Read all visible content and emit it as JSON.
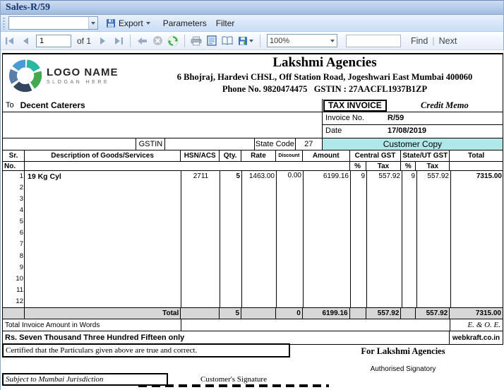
{
  "window": {
    "title": "Sales-R/59"
  },
  "toolbar": {
    "report_combo_value": "",
    "export_label": "Export",
    "parameters_label": "Parameters",
    "filter_label": "Filter"
  },
  "nav": {
    "page_value": "1",
    "of_label": "of 1",
    "zoom_value": "100%",
    "find_value": "",
    "find_label": "Find",
    "separator": "|",
    "next_label": "Next"
  },
  "company": {
    "logo_name": "LOGO NAME",
    "logo_slogan": "SLOGAN HERE",
    "name": "Lakshmi Agencies",
    "address": "6 Bhojraj, Hardevi CHSL, Off Station Road, Jogeshwari East Mumbai 400060",
    "phone_line": "Phone No. 9820474475   GSTIN : 27AACFL1937B1ZP"
  },
  "invoice": {
    "to_label": "To",
    "to_name": "Decent Caterers",
    "type_label": "TAX INVOICE",
    "memo_label": "Credit Memo",
    "invoice_no_label": "Invoice No.",
    "invoice_no": "R/59",
    "date_label": "Date",
    "date": "17/08/2019",
    "gstin_label": "GSTIN",
    "gstin_value": "",
    "state_code_label": "State Code",
    "state_code": "27",
    "copy_label": "Customer Copy"
  },
  "table": {
    "col_sr": "Sr.",
    "col_no": "No.",
    "col_desc": "Description of Goods/Services",
    "col_hsn": "HSN/ACS",
    "col_qty": "Qty.",
    "col_rate": "Rate",
    "col_discount": "Discount",
    "col_amount": "Amount",
    "col_cgst": "Central GST",
    "col_sgst": "State/UT GST",
    "col_total": "Total",
    "col_pct": "%",
    "col_tax": "Tax",
    "sr_numbers": [
      "1",
      "2",
      "3",
      "4",
      "5",
      "6",
      "7",
      "8",
      "9",
      "10",
      "11",
      "12"
    ],
    "row1": {
      "desc": "19 Kg Cyl",
      "hsn": "2711",
      "qty": "5",
      "rate": "1463.00",
      "discount": "0.00",
      "amount": "6199.16",
      "cgst_pct": "9",
      "cgst_tax": "557.92",
      "sgst_pct": "9",
      "sgst_tax": "557.92",
      "total": "7315.00"
    },
    "totals": {
      "label": "Total",
      "qty": "5",
      "discount": "0",
      "amount": "6199.16",
      "cgst_tax": "557.92",
      "sgst_tax": "557.92",
      "total": "7315.00"
    }
  },
  "footer": {
    "words_label": "Total Invoice Amount in Words",
    "eoe": "E. & O. E.",
    "amount_words": "Rs. Seven Thousand Three Hundred Fifteen only",
    "brand": "webkraft.co.in",
    "certified": "Certified that the Particulars given above are true and correct.",
    "for_company": "For Lakshmi Agencies",
    "authorised": "Authorised Signatory",
    "jurisdiction": "Subject to Mumbai Jurisdiction",
    "customer_sign": "Customer's Signature"
  },
  "colors": {
    "copy_band": "#b0e8ea",
    "total_row": "#d7d7d7",
    "titlebar_text": "#15356e"
  }
}
